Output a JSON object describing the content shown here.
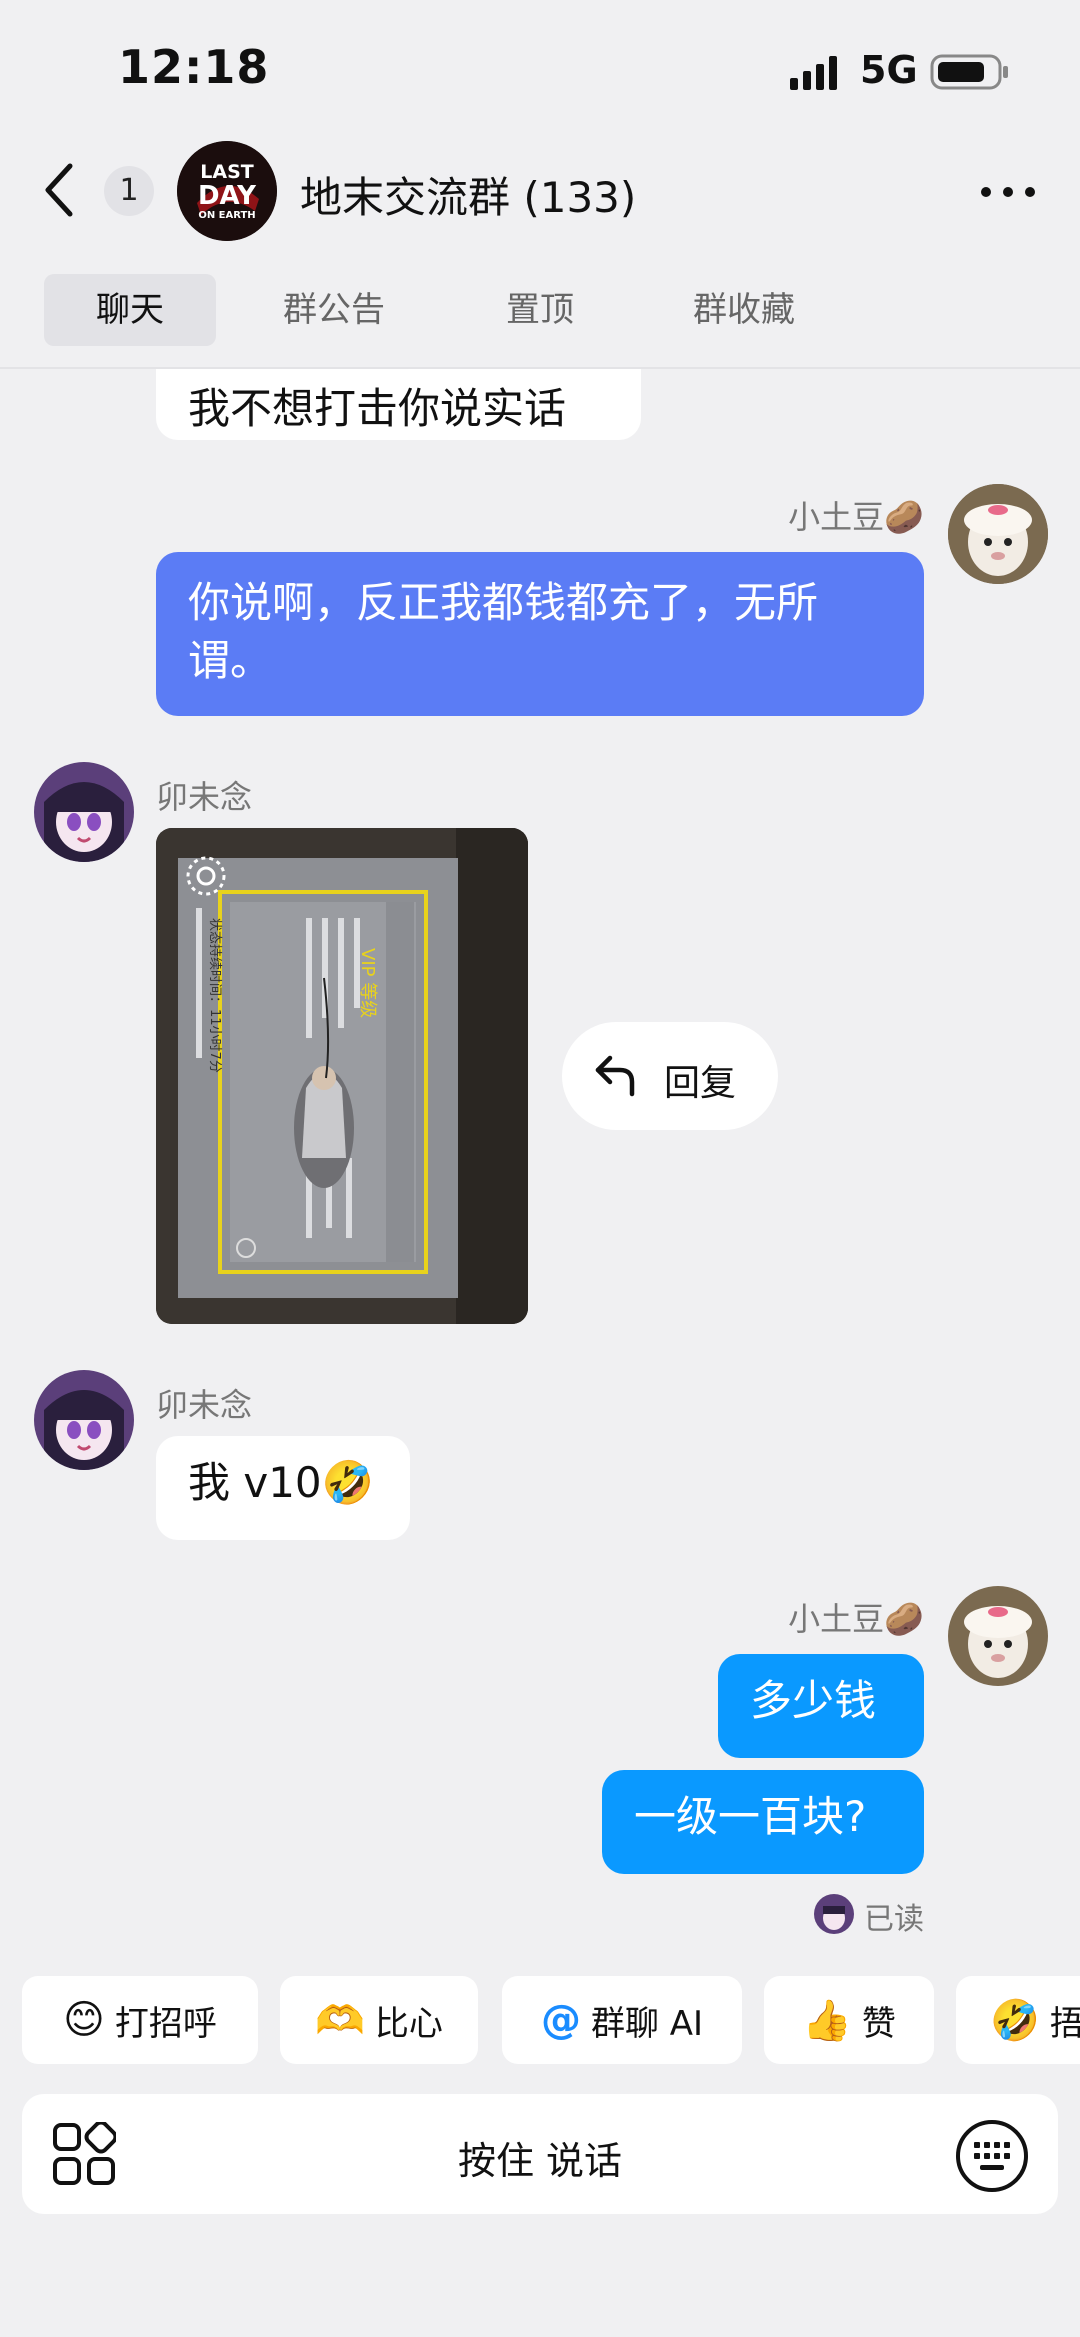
{
  "status_bar": {
    "time": "12:18",
    "network": "5G"
  },
  "header": {
    "back_badge": "1",
    "title": "地末交流群 (133)",
    "avatar_text": [
      "LAST",
      "DAY",
      "ON EARTH"
    ]
  },
  "tabs": [
    {
      "label": "聊天",
      "active": true
    },
    {
      "label": "群公告",
      "active": false
    },
    {
      "label": "置顶",
      "active": false
    },
    {
      "label": "群收藏",
      "active": false
    }
  ],
  "messages": {
    "m0": {
      "text": "我不想打击你说实话",
      "direction": "in"
    },
    "m1": {
      "sender": "小土豆🥔",
      "text": "你说啊，反正我都钱都充了，无所谓。",
      "direction": "out"
    },
    "m2": {
      "sender": "卯未念",
      "type": "image",
      "direction": "in",
      "image_text": {
        "title": "VIP 等级",
        "line": "状态持续时间：11小时7分"
      }
    },
    "m3": {
      "sender": "卯未念",
      "text": "我 v10🤣",
      "direction": "in"
    },
    "m4": {
      "sender": "小土豆🥔",
      "texts": [
        "多少钱",
        "一级一百块?"
      ],
      "direction": "out"
    },
    "read_receipt": "已读"
  },
  "reply_button": {
    "label": "回复"
  },
  "quick_actions": [
    {
      "emoji": "😊",
      "label": "打招呼"
    },
    {
      "emoji": "🫶",
      "label": "比心"
    },
    {
      "emoji": "@",
      "label": "群聊 AI"
    },
    {
      "emoji": "👍",
      "label": "赞"
    },
    {
      "emoji": "🤣",
      "label": "捂"
    }
  ],
  "input": {
    "voice_label": "按住 说话"
  },
  "colors": {
    "outgoing_bubble": "#0a99ff",
    "outgoing_bubble_alt": "#5b7cf5",
    "background": "#f0f0f2"
  }
}
